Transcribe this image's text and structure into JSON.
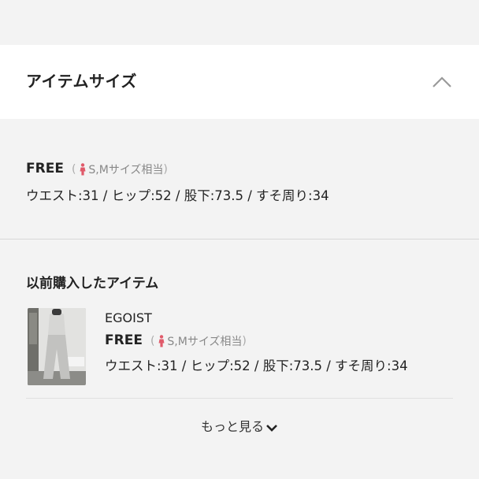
{
  "section": {
    "title": "アイテムサイズ",
    "collapse_icon": "chevron-up-icon"
  },
  "size": {
    "name": "FREE",
    "equiv_open": "(",
    "equiv_label": "S,Mサイズ相当",
    "equiv_close": ")",
    "figure_icon": "woman-figure-icon",
    "figure_color": "#e05a6a",
    "measurements": "ウエスト:31 / ヒップ:52 / 股下:73.5 / すそ周り:34"
  },
  "history": {
    "title": "以前購入したアイテム",
    "items": [
      {
        "brand": "EGOIST",
        "size": "FREE",
        "equiv_open": "(",
        "equiv_label": "S,Mサイズ相当",
        "equiv_close": ")",
        "measurements": "ウエスト:31 / ヒップ:52 / 股下:73.5 / すそ周り:34"
      }
    ]
  },
  "more": {
    "label": "もっと見る",
    "icon": "chevron-down-icon"
  }
}
